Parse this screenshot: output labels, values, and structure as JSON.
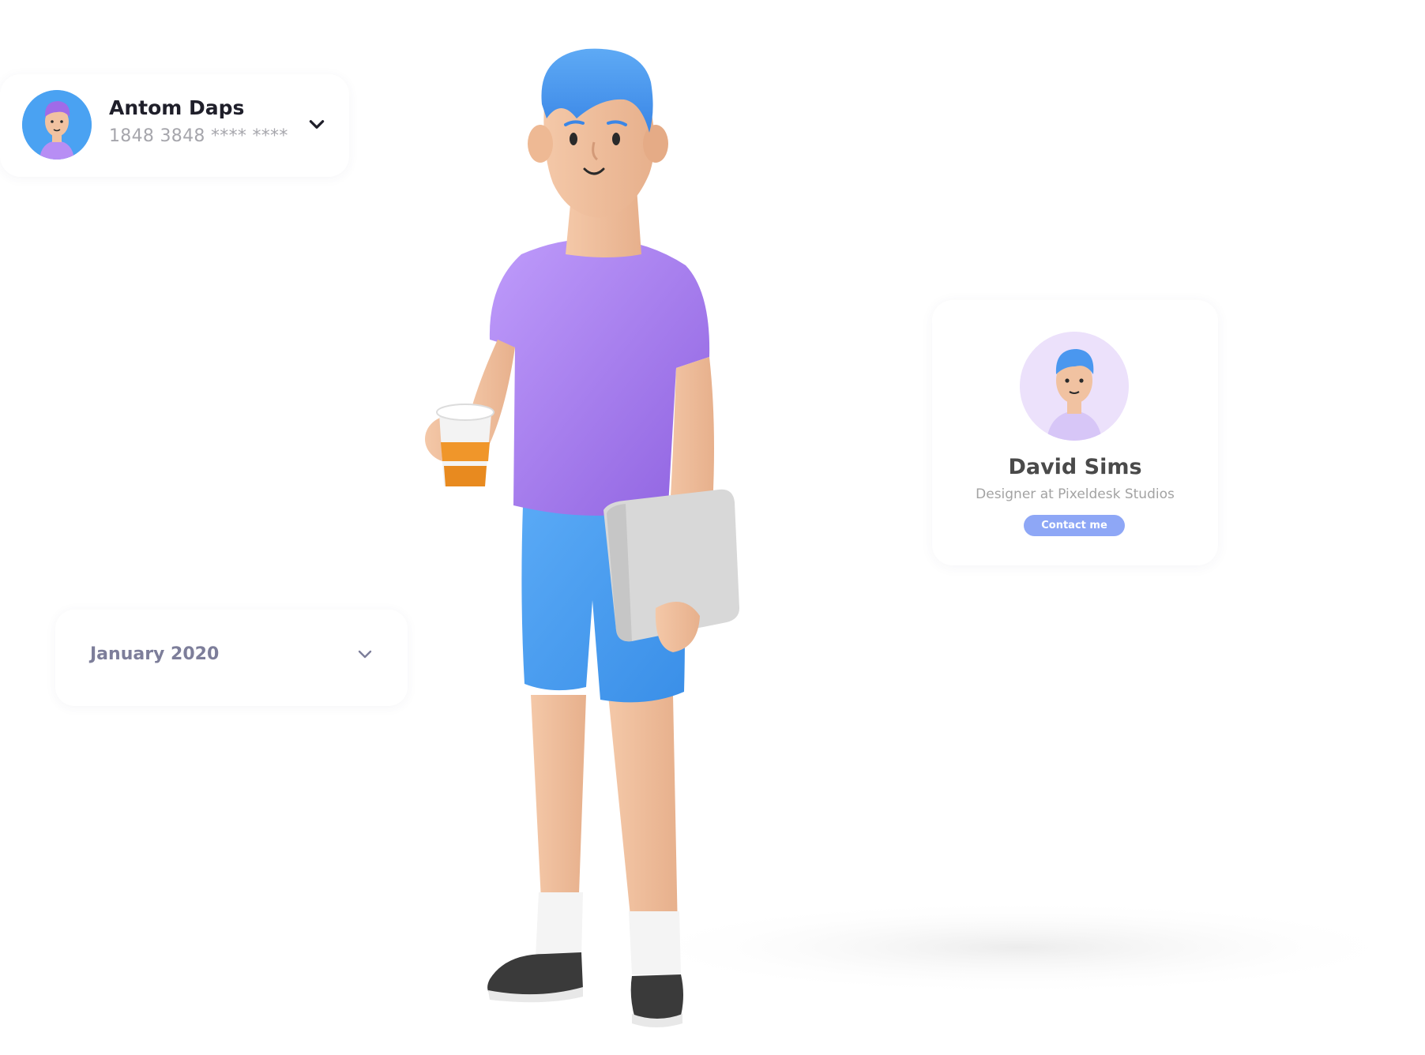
{
  "account": {
    "name": "Antom Daps",
    "card_number": "1848 3848 **** ****",
    "avatar_icon": "user-avatar-purple-hair",
    "dropdown_icon": "chevron-down-icon"
  },
  "month_picker": {
    "selected": "January 2020",
    "dropdown_icon": "chevron-down-icon"
  },
  "profile": {
    "name": "David Sims",
    "role": "Designer at Pixeldesk Studios",
    "contact_label": "Contact me",
    "avatar_icon": "user-avatar-blue-hair"
  },
  "colors": {
    "accent": "#8ea7f6",
    "shirt": "#a77ef0",
    "shorts": "#4b9ff2",
    "hair": "#4a97ef",
    "skin": "#f1c2a1"
  }
}
